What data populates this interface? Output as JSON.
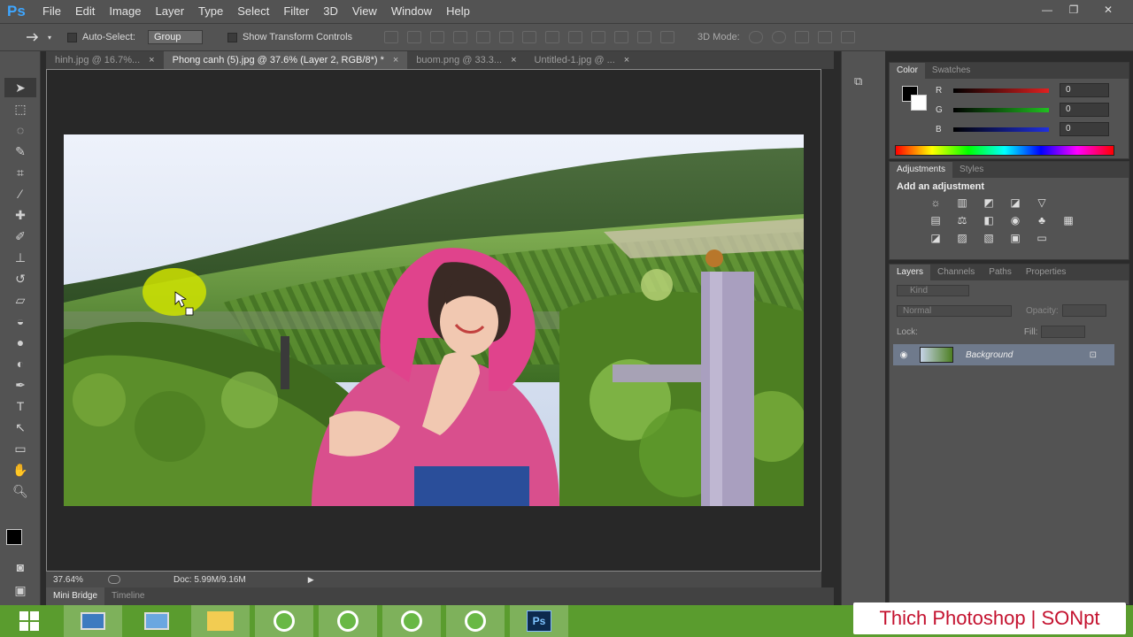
{
  "app": {
    "logo": "Ps"
  },
  "menu": [
    "File",
    "Edit",
    "Image",
    "Layer",
    "Type",
    "Select",
    "Filter",
    "3D",
    "View",
    "Window",
    "Help"
  ],
  "window_controls": {
    "minimize": "—",
    "restore": "❐",
    "close": "✕"
  },
  "options": {
    "auto_select_label": "Auto-Select:",
    "group_value": "Group",
    "show_transform_label": "Show Transform Controls",
    "mode_3d": "3D Mode:"
  },
  "tabs": [
    {
      "title": "hinh.jpg @ 16.7%...",
      "close": "×"
    },
    {
      "title": "Phong canh (5).jpg @ 37.6% (Layer 2, RGB/8*) *",
      "close": "×"
    },
    {
      "title": "buom.png @ 33.3...",
      "close": "×"
    },
    {
      "title": "Untitled-1.jpg @ ...",
      "close": "×"
    }
  ],
  "status": {
    "zoom": "37.64%",
    "doc": "Doc: 5.99M/9.16M"
  },
  "bottom_tabs": [
    "Mini Bridge",
    "Timeline"
  ],
  "color_panel": {
    "tabs": [
      "Color",
      "Swatches"
    ],
    "rows": [
      {
        "label": "R",
        "value": "0",
        "color": "#e02020"
      },
      {
        "label": "G",
        "value": "0",
        "color": "#20c020"
      },
      {
        "label": "B",
        "value": "0",
        "color": "#2030e0"
      }
    ]
  },
  "adjustments_panel": {
    "tabs": [
      "Adjustments",
      "Styles"
    ],
    "heading": "Add an adjustment"
  },
  "layers_panel": {
    "tabs": [
      "Layers",
      "Channels",
      "Paths",
      "Properties"
    ],
    "kind": "Kind",
    "blend_mode": "Normal",
    "opacity_label": "Opacity:",
    "lock_label": "Lock:",
    "fill_label": "Fill:",
    "layer_name": "Background"
  },
  "watermark": "Thich Photoshop | SONpt"
}
